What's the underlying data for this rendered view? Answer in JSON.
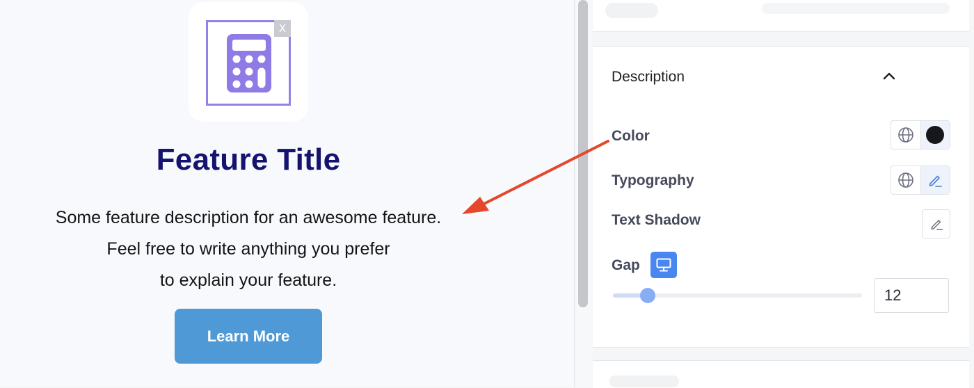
{
  "canvas": {
    "image_close_label": "X",
    "feature_title": "Feature Title",
    "description_lines": [
      "Some feature description for an awesome feature.",
      "Feel free to write anything you prefer",
      "to explain your feature."
    ],
    "button_label": "Learn More"
  },
  "panel": {
    "section_title": "Description",
    "color_label": "Color",
    "typography_label": "Typography",
    "text_shadow_label": "Text Shadow",
    "gap_label": "Gap",
    "gap_value": "12",
    "gap_slider_fraction": 0.14,
    "swatch_color": "#15171c",
    "accent_color": "#4a86f0"
  },
  "annotation": {
    "arrow_color": "#e4472c"
  }
}
